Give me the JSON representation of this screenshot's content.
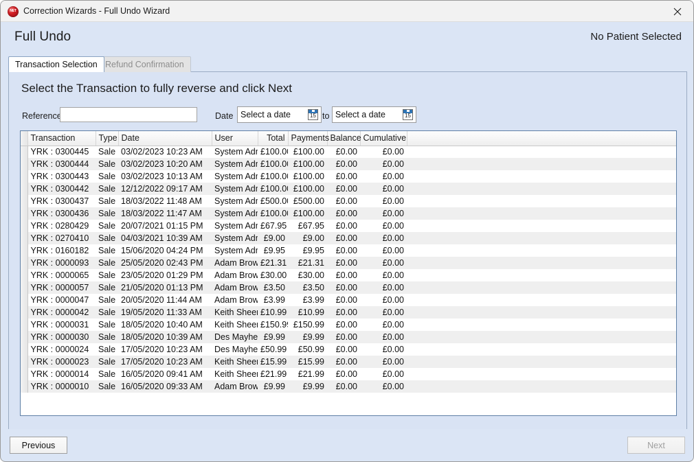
{
  "window": {
    "title": "Correction Wizards - Full Undo Wizard",
    "icon": "dotnet-sphere-icon",
    "net_badge": "NET",
    "close_label": "close-icon"
  },
  "header": {
    "page_title": "Full Undo",
    "patient_status": "No Patient Selected"
  },
  "tabs": [
    {
      "label": "Transaction Selection",
      "active": true
    },
    {
      "label": "Refund Confirmation",
      "active": false
    }
  ],
  "content": {
    "instruction": "Select the Transaction to fully reverse and click Next"
  },
  "filters": {
    "reference_label": "Reference",
    "reference_value": "",
    "reference_placeholder": "",
    "date_label": "Date",
    "to_label": "to",
    "date_from_value": "Select a date",
    "date_to_value": "Select a date",
    "calendar_icon_day": "15"
  },
  "grid": {
    "columns": [
      {
        "key": "rowhdr",
        "label": "",
        "align": "left"
      },
      {
        "key": "transaction",
        "label": "Transaction",
        "align": "left"
      },
      {
        "key": "type",
        "label": "Type",
        "align": "left"
      },
      {
        "key": "date",
        "label": "Date",
        "align": "left"
      },
      {
        "key": "user",
        "label": "User",
        "align": "left"
      },
      {
        "key": "total",
        "label": "Total",
        "align": "right"
      },
      {
        "key": "payments",
        "label": "Payments",
        "align": "right"
      },
      {
        "key": "balance",
        "label": "Balance",
        "align": "right"
      },
      {
        "key": "cumulative",
        "label": "Cumulative",
        "align": "right"
      },
      {
        "key": "filler",
        "label": "",
        "align": "left"
      }
    ],
    "rows": [
      [
        "",
        "YRK : 0300445",
        "Sale",
        "03/02/2023 10:23 AM",
        "System Admin",
        "£100.00",
        "£100.00",
        "£0.00",
        "£0.00",
        ""
      ],
      [
        "",
        "YRK : 0300444",
        "Sale",
        "03/02/2023 10:20 AM",
        "System Admin",
        "£100.00",
        "£100.00",
        "£0.00",
        "£0.00",
        ""
      ],
      [
        "",
        "YRK : 0300443",
        "Sale",
        "03/02/2023 10:13 AM",
        "System Admin",
        "£100.00",
        "£100.00",
        "£0.00",
        "£0.00",
        ""
      ],
      [
        "",
        "YRK : 0300442",
        "Sale",
        "12/12/2022 09:17 AM",
        "System Admin",
        "£100.00",
        "£100.00",
        "£0.00",
        "£0.00",
        ""
      ],
      [
        "",
        "YRK : 0300437",
        "Sale",
        "18/03/2022 11:48 AM",
        "System Admin",
        "£500.00",
        "£500.00",
        "£0.00",
        "£0.00",
        ""
      ],
      [
        "",
        "YRK : 0300436",
        "Sale",
        "18/03/2022 11:47 AM",
        "System Admin",
        "£100.00",
        "£100.00",
        "£0.00",
        "£0.00",
        ""
      ],
      [
        "",
        "YRK : 0280429",
        "Sale",
        "20/07/2021 01:15 PM",
        "System Admin",
        "£67.95",
        "£67.95",
        "£0.00",
        "£0.00",
        ""
      ],
      [
        "",
        "YRK : 0270410",
        "Sale",
        "04/03/2021 10:39 AM",
        "System Admin",
        "£9.00",
        "£9.00",
        "£0.00",
        "£0.00",
        ""
      ],
      [
        "",
        "YRK : 0160182",
        "Sale",
        "15/06/2020 04:24 PM",
        "System Admin",
        "£9.95",
        "£9.95",
        "£0.00",
        "£0.00",
        ""
      ],
      [
        "",
        "YRK : 0000093",
        "Sale",
        "25/05/2020 02:43 PM",
        "Adam Brown",
        "£21.31",
        "£21.31",
        "£0.00",
        "£0.00",
        ""
      ],
      [
        "",
        "YRK : 0000065",
        "Sale",
        "23/05/2020 01:29 PM",
        "Adam Brown",
        "£30.00",
        "£30.00",
        "£0.00",
        "£0.00",
        ""
      ],
      [
        "",
        "YRK : 0000057",
        "Sale",
        "21/05/2020 01:13 PM",
        "Adam Brown",
        "£3.50",
        "£3.50",
        "£0.00",
        "£0.00",
        ""
      ],
      [
        "",
        "YRK : 0000047",
        "Sale",
        "20/05/2020 11:44 AM",
        "Adam Brown",
        "£3.99",
        "£3.99",
        "£0.00",
        "£0.00",
        ""
      ],
      [
        "",
        "YRK : 0000042",
        "Sale",
        "19/05/2020 11:33 AM",
        "Keith Sheers",
        "£10.99",
        "£10.99",
        "£0.00",
        "£0.00",
        ""
      ],
      [
        "",
        "YRK : 0000031",
        "Sale",
        "18/05/2020 10:40 AM",
        "Keith Sheers",
        "£150.99",
        "£150.99",
        "£0.00",
        "£0.00",
        ""
      ],
      [
        "",
        "YRK : 0000030",
        "Sale",
        "18/05/2020 10:39 AM",
        "Des Mayhew",
        "£9.99",
        "£9.99",
        "£0.00",
        "£0.00",
        ""
      ],
      [
        "",
        "YRK : 0000024",
        "Sale",
        "17/05/2020 10:23 AM",
        "Des Mayhew",
        "£50.99",
        "£50.99",
        "£0.00",
        "£0.00",
        ""
      ],
      [
        "",
        "YRK : 0000023",
        "Sale",
        "17/05/2020 10:23 AM",
        "Keith Sheers",
        "£15.99",
        "£15.99",
        "£0.00",
        "£0.00",
        ""
      ],
      [
        "",
        "YRK : 0000014",
        "Sale",
        "16/05/2020 09:41 AM",
        "Keith Sheers",
        "£21.99",
        "£21.99",
        "£0.00",
        "£0.00",
        ""
      ],
      [
        "",
        "YRK : 0000010",
        "Sale",
        "16/05/2020 09:33 AM",
        "Adam Brown",
        "£9.99",
        "£9.99",
        "£0.00",
        "£0.00",
        ""
      ]
    ]
  },
  "footer": {
    "previous_label": "Previous",
    "next_label": "Next",
    "next_enabled": false
  },
  "colors": {
    "panel_blue": "#d9e3f4",
    "header_blue": "#dbe5f5",
    "grid_border": "#5e7fa5",
    "stripe": "#efefef",
    "accent_calendar": "#2e74b5",
    "icon_red": "#d01c22"
  }
}
